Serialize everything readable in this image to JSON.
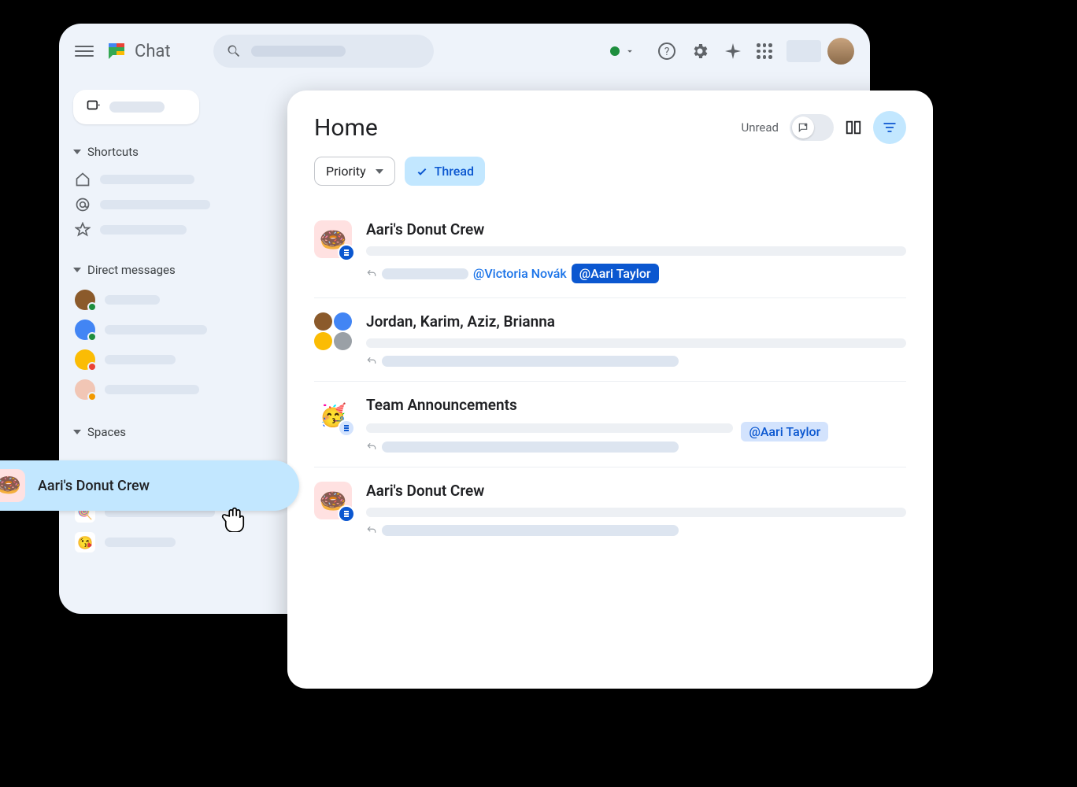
{
  "header": {
    "app_name": "Chat"
  },
  "sidebar": {
    "sections": {
      "shortcuts": {
        "label": "Shortcuts"
      },
      "dms": {
        "label": "Direct messages"
      },
      "spaces": {
        "label": "Spaces"
      }
    },
    "highlighted_space": "Aari's Donut Crew"
  },
  "main": {
    "title": "Home",
    "unread_label": "Unread",
    "filter_priority": "Priority",
    "filter_thread": "Thread",
    "conversations": [
      {
        "title": "Aari's Donut Crew",
        "mention_link": "@Victoria Novák",
        "mention_chip": "@Aari Taylor",
        "chip_style": "dark",
        "has_badge": true
      },
      {
        "title": "Jordan, Karim, Aziz, Brianna",
        "group": true
      },
      {
        "title": "Team Announcements",
        "emoji": "🥳",
        "mention_chip": "@Aari Taylor",
        "chip_style": "light",
        "has_badge": true,
        "badge_light": true
      },
      {
        "title": "Aari's Donut Crew",
        "has_badge": true
      }
    ]
  }
}
